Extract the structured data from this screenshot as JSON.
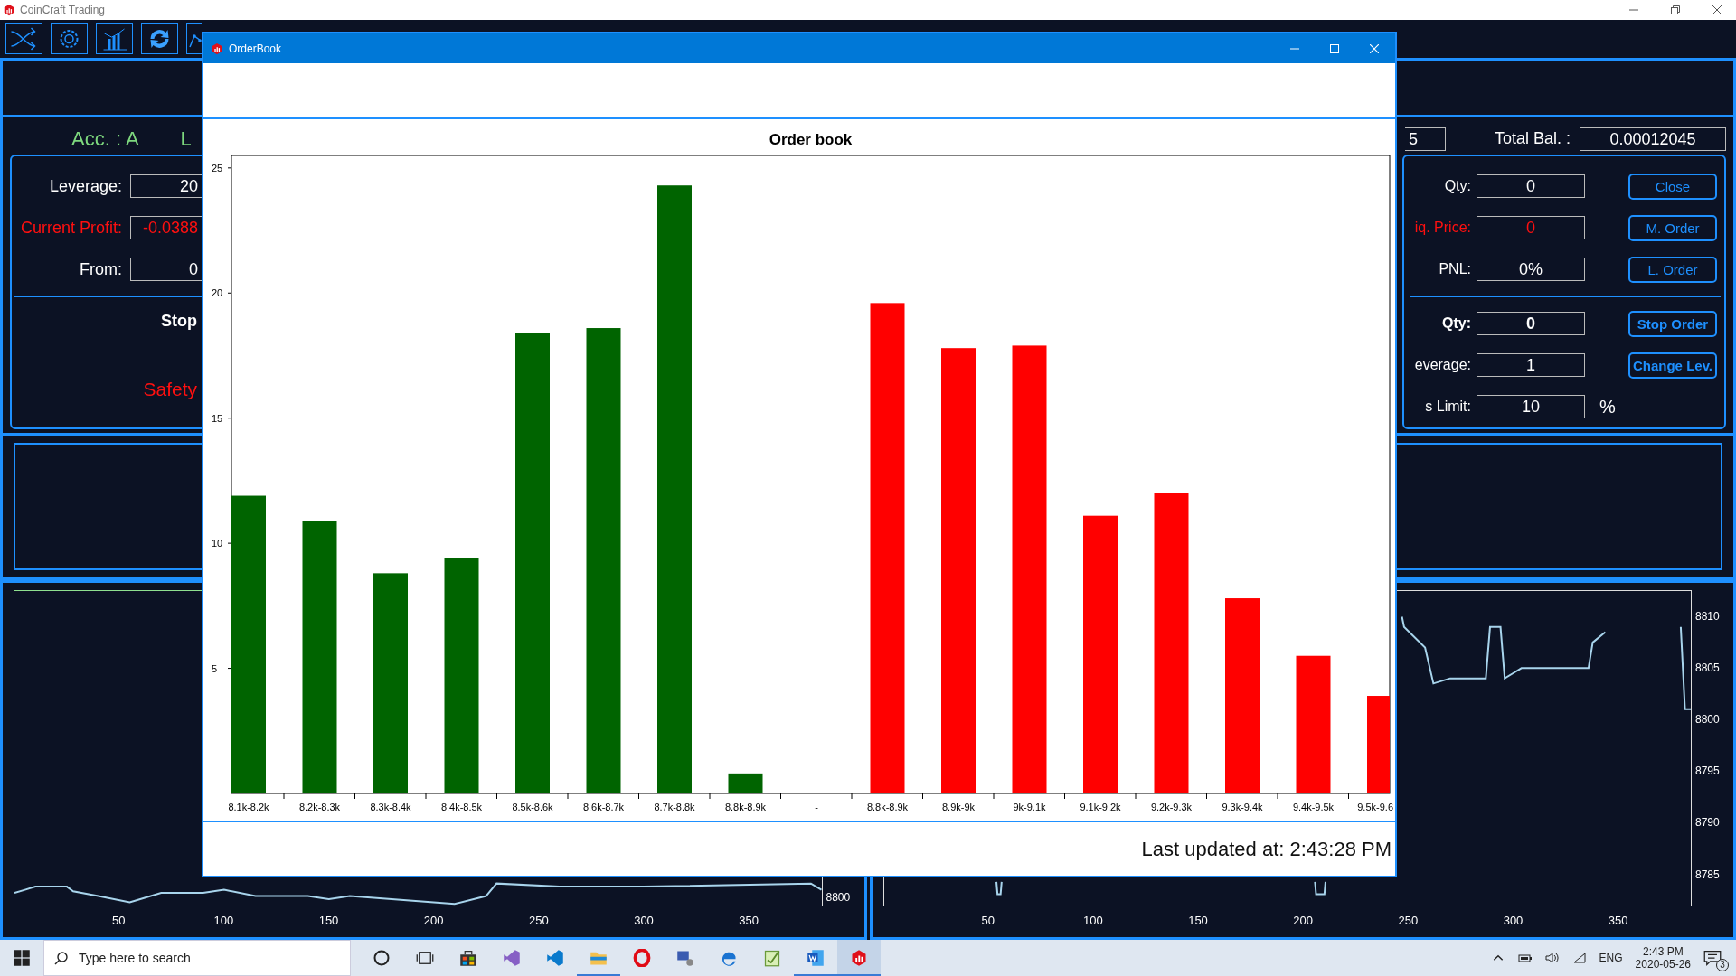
{
  "window": {
    "title": "CoinCraft Trading"
  },
  "account": {
    "label": "Acc. : A",
    "covered_label": "L"
  },
  "balance": {
    "field": "5",
    "total_label": "Total Bal. :",
    "total_value": "0.00012045"
  },
  "left_form": {
    "rows": [
      {
        "label": "Leverage:",
        "value": "20",
        "kind": "normal"
      },
      {
        "label": "Current Profit:",
        "value": "-0.0388",
        "kind": "alert"
      },
      {
        "label": "From:",
        "value": "0",
        "kind": "normal"
      }
    ],
    "section_title": "Stop",
    "warning": "Safety"
  },
  "right_form": {
    "rows": [
      {
        "label": "Qty:",
        "value": "0",
        "kind": "normal",
        "button": {
          "label": "Close",
          "emphasis": false
        }
      },
      {
        "label": "iq. Price:",
        "value": "0",
        "kind": "alert",
        "button": {
          "label": "M. Order",
          "emphasis": false
        }
      },
      {
        "label": "PNL:",
        "value": "0%",
        "kind": "normal",
        "button": {
          "label": "L. Order",
          "emphasis": false
        }
      }
    ],
    "rows_2": [
      {
        "label": "Qty:",
        "value": "0",
        "kind": "bold",
        "button": {
          "label": "Stop Order",
          "emphasis": true
        }
      },
      {
        "label": "everage:",
        "value": "1",
        "kind": "normal",
        "button": {
          "label": "Change Lev.",
          "emphasis": true
        }
      },
      {
        "label": "s Limit:",
        "value": "10",
        "kind": "normal",
        "unit": "%"
      }
    ]
  },
  "price_charts": [
    {
      "x_ticks": [
        "50",
        "100",
        "150",
        "200",
        "250",
        "300",
        "350"
      ],
      "y_ticks": [
        "8800"
      ]
    },
    {
      "chart_data": {
        "type": "line",
        "x": [
          53.5,
          54,
          55.5,
          56,
          205.5,
          206,
          210,
          210.5,
          247,
          248,
          258,
          262,
          270,
          287,
          289,
          294,
          296,
          300,
          304,
          336,
          338,
          344,
          380,
          382,
          385
        ],
        "series": [
          {
            "color": "#a8d4ec",
            "values": [
              8784.2,
              8783,
              8783,
              8784.2,
              8784.2,
              8783,
              8783,
              8784.2,
              8810,
              8809,
              8807,
              8803.5,
              8804,
              8804,
              8809,
              8809,
              8804,
              8804.5,
              8805,
              8805,
              8807.5,
              8808.5,
              8809,
              8801,
              8801
            ]
          }
        ],
        "xlim": [
          0,
          385
        ],
        "ylim": [
          8781.9,
          8812.5
        ],
        "xticks": [
          50,
          100,
          150,
          200,
          250,
          300,
          350
        ],
        "yticks": [
          8810,
          8805,
          8800,
          8795,
          8790,
          8785
        ]
      }
    }
  ],
  "dialog": {
    "title": "OrderBook",
    "status": "Last updated at: 2:43:28 PM",
    "chart_data": {
      "type": "bar",
      "title": "Order book",
      "categories": [
        "8.1k-8.2k",
        "8.2k-8.3k",
        "8.3k-8.4k",
        "8.4k-8.5k",
        "8.5k-8.6k",
        "8.6k-8.7k",
        "8.7k-8.8k",
        "8.8k-8.9k",
        "-",
        "8.8k-8.9k",
        "8.9k-9k",
        "9k-9.1k",
        "9.1k-9.2k",
        "9.2k-9.3k",
        "9.3k-9.4k",
        "9.4k-9.5k",
        "9.5k-9.6"
      ],
      "series": [
        {
          "color": "#006400",
          "values": [
            11.9,
            10.9,
            8.8,
            9.4,
            18.4,
            18.6,
            24.3,
            0.8,
            null,
            null,
            null,
            null,
            null,
            null,
            null,
            null,
            null
          ]
        },
        {
          "color": "#ff0000",
          "values": [
            null,
            null,
            null,
            null,
            null,
            null,
            null,
            null,
            null,
            19.6,
            17.8,
            17.9,
            11.1,
            12.0,
            7.8,
            5.5,
            3.9
          ]
        }
      ],
      "ylim": [
        0,
        25.5
      ],
      "yticks": [
        5,
        10,
        15,
        20,
        25
      ]
    }
  },
  "taskbar": {
    "search": {
      "placeholder": "Type here to search"
    },
    "language": "ENG",
    "time": "2:43 PM",
    "date": "2020-05-26",
    "notifications": "3"
  }
}
